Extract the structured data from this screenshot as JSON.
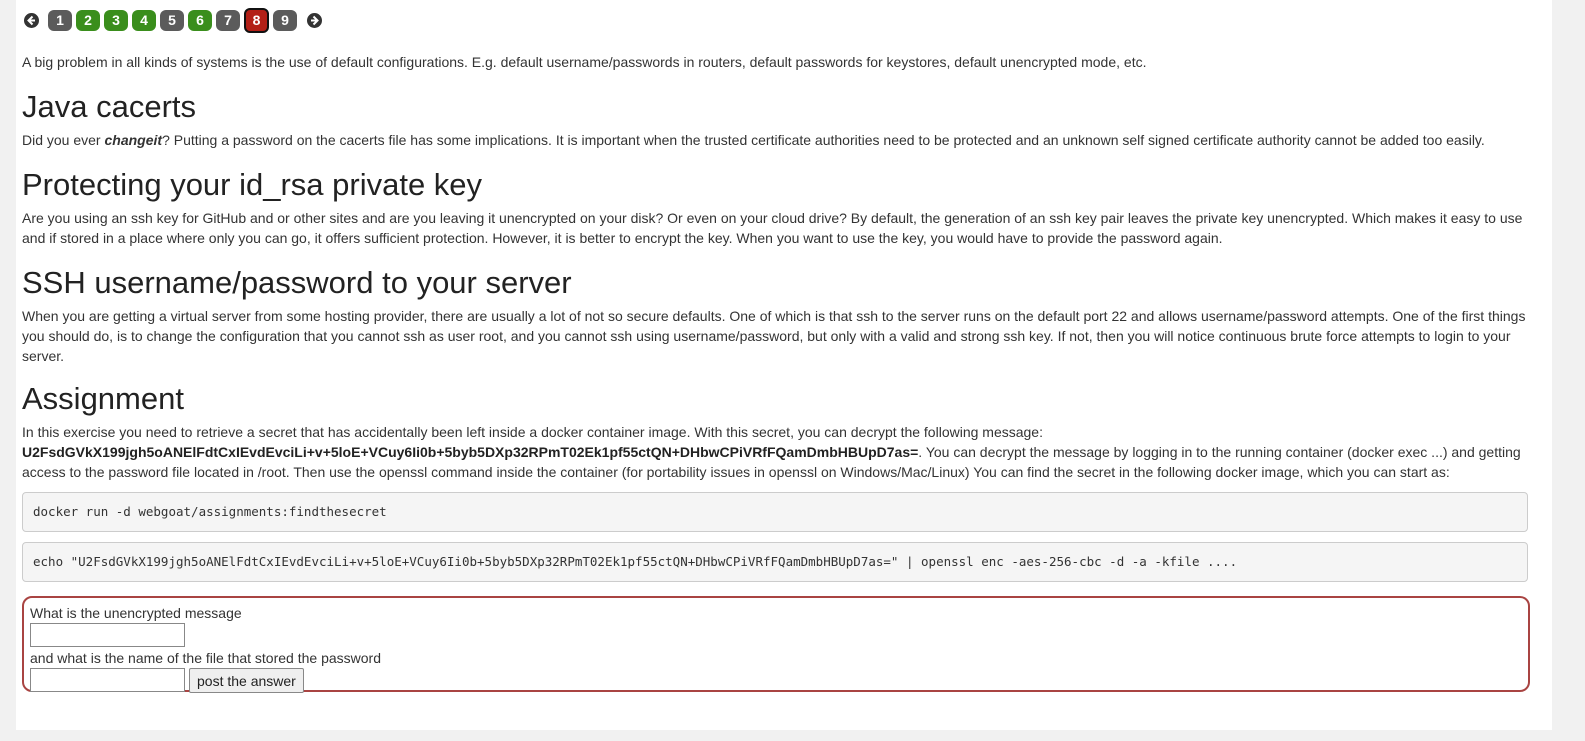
{
  "pagination": {
    "prev_icon": "arrow-left-circle-icon",
    "next_icon": "arrow-right-circle-icon",
    "pages": [
      {
        "label": "1",
        "state": "grey"
      },
      {
        "label": "2",
        "state": "green"
      },
      {
        "label": "3",
        "state": "green"
      },
      {
        "label": "4",
        "state": "green"
      },
      {
        "label": "5",
        "state": "grey"
      },
      {
        "label": "6",
        "state": "green"
      },
      {
        "label": "7",
        "state": "grey"
      },
      {
        "label": "8",
        "state": "red"
      },
      {
        "label": "9",
        "state": "grey"
      }
    ],
    "colors": {
      "grey": "#5b5b5b",
      "green": "#3a8e1c",
      "red": "#b32017"
    }
  },
  "intro": "A big problem in all kinds of systems is the use of default configurations. E.g. default username/passwords in routers, default passwords for keystores, default unencrypted mode, etc.",
  "java": {
    "title": "Java cacerts",
    "text_before": "Did you ever ",
    "emphasis": "changeit",
    "text_after": "? Putting a password on the cacerts file has some implications. It is important when the trusted certificate authorities need to be protected and an unknown self signed certificate authority cannot be added too easily."
  },
  "rsa": {
    "title": "Protecting your id_rsa private key",
    "text": "Are you using an ssh key for GitHub and or other sites and are you leaving it unencrypted on your disk? Or even on your cloud drive? By default, the generation of an ssh key pair leaves the private key unencrypted. Which makes it easy to use and if stored in a place where only you can go, it offers sufficient protection. However, it is better to encrypt the key. When you want to use the key, you would have to provide the password again."
  },
  "ssh": {
    "title": "SSH username/password to your server",
    "text": "When you are getting a virtual server from some hosting provider, there are usually a lot of not so secure defaults. One of which is that ssh to the server runs on the default port 22 and allows username/password attempts. One of the first things you should do, is to change the configuration that you cannot ssh as user root, and you cannot ssh using username/password, but only with a valid and strong ssh key. If not, then you will notice continuous brute force attempts to login to your server."
  },
  "assignment": {
    "title": "Assignment",
    "text_before": "In this exercise you need to retrieve a secret that has accidentally been left inside a docker container image. With this secret, you can decrypt the following message: ",
    "encrypted": "U2FsdGVkX199jgh5oANElFdtCxIEvdEvciLi+v+5loE+VCuy6Ii0b+5byb5DXp32RPmT02Ek1pf55ctQN+DHbwCPiVRfFQamDmbHBUpD7as=",
    "text_after": ". You can decrypt the message by logging in to the running container (docker exec ...) and getting access to the password file located in /root. Then use the openssl command inside the container (for portability issues in openssl on Windows/Mac/Linux) You can find the secret in the following docker image, which you can start as:",
    "code1": "docker run -d webgoat/assignments:findthesecret",
    "code2": "echo \"U2FsdGVkX199jgh5oANElFdtCxIEvdEvciLi+v+5loE+VCuy6Ii0b+5byb5DXp32RPmT02Ek1pf55ctQN+DHbwCPiVRfFQamDmbHBUpD7as=\" | openssl enc -aes-256-cbc -d -a -kfile ...."
  },
  "form": {
    "label_message": "What is the unencrypted message",
    "message_value": "",
    "label_file": "and what is the name of the file that stored the password",
    "file_value": "",
    "submit_label": "post the answer",
    "border_color": "#a94442"
  }
}
